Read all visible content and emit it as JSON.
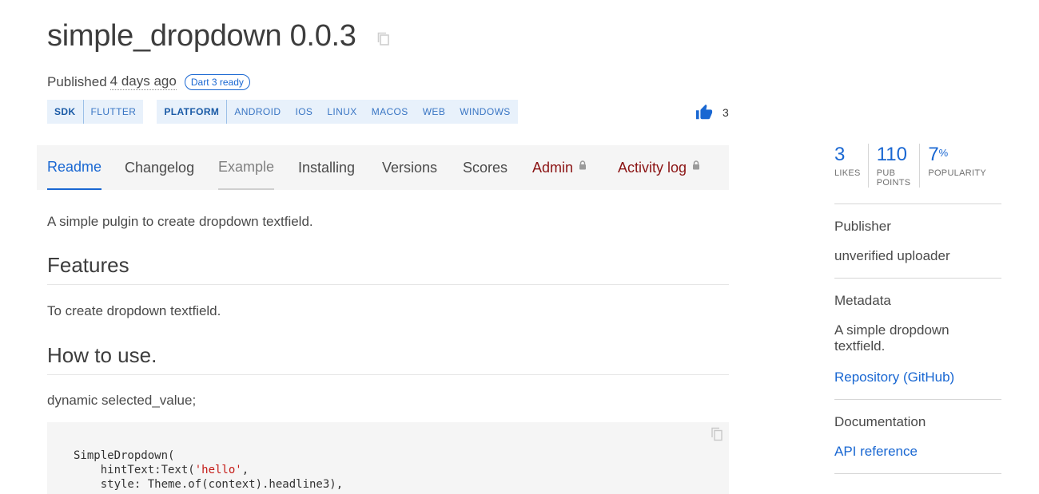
{
  "package": {
    "title": "simple_dropdown 0.0.3",
    "published_prefix": "Published",
    "published_ago": "4 days ago",
    "dart3_badge": "Dart 3 ready"
  },
  "tags": {
    "sdk": {
      "head": "SDK",
      "items": [
        "FLUTTER"
      ]
    },
    "platform": {
      "head": "PLATFORM",
      "items": [
        "ANDROID",
        "IOS",
        "LINUX",
        "MACOS",
        "WEB",
        "WINDOWS"
      ]
    }
  },
  "like_count": "3",
  "tabs": [
    {
      "label": "Readme"
    },
    {
      "label": "Changelog"
    },
    {
      "label": "Example"
    },
    {
      "label": "Installing"
    },
    {
      "label": "Versions"
    },
    {
      "label": "Scores"
    },
    {
      "label": "Admin"
    },
    {
      "label": "Activity log"
    }
  ],
  "readme": {
    "intro": "A simple pulgin to create dropdown textfield.",
    "features_heading": "Features",
    "features_text": "To create dropdown textfield.",
    "howto_heading": "How to use.",
    "howto_text": "dynamic selected_value;",
    "code": {
      "line1": "SimpleDropdown(",
      "line2_prefix": "    hintText:Text(",
      "line2_string": "'hello'",
      "line2_suffix": ",",
      "line3": "    style: Theme.of(context).headline3),"
    }
  },
  "sidebar": {
    "stats": [
      {
        "value": "3",
        "suffix": "",
        "label": "LIKES"
      },
      {
        "value": "110",
        "suffix": "",
        "label": "PUB POINTS"
      },
      {
        "value": "7",
        "suffix": "%",
        "label": "POPULARITY"
      }
    ],
    "publisher_heading": "Publisher",
    "publisher_value": "unverified uploader",
    "metadata_heading": "Metadata",
    "metadata_description": "A simple dropdown textfield.",
    "repository_link": "Repository (GitHub)",
    "documentation_heading": "Documentation",
    "api_reference_link": "API reference"
  },
  "colors": {
    "accent": "#1967d2",
    "admin": "#8b1414",
    "tag_bg": "#e8f1fb",
    "tab_bg": "#f5f5f5"
  },
  "icons": [
    "copy-icon",
    "thumbs-up-icon",
    "lock-icon"
  ]
}
